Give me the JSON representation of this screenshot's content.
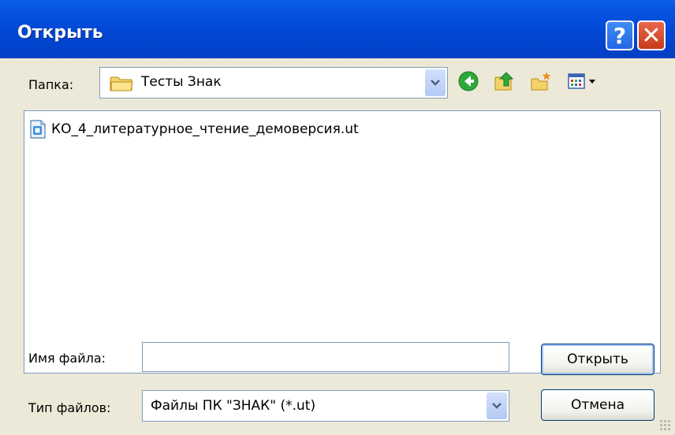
{
  "window": {
    "title": "Открыть",
    "help_label": "?",
    "close_label": "✕"
  },
  "lookin": {
    "label": "Папка:",
    "value": "Тесты Знак"
  },
  "toolbar": {
    "icons": [
      "back-icon",
      "up-folder-icon",
      "new-folder-icon",
      "view-menu-icon"
    ]
  },
  "files": [
    {
      "name": "КО_4_литературное_чтение_демоверсия.ut"
    }
  ],
  "filename": {
    "label": "Имя файла:",
    "value": "",
    "placeholder": ""
  },
  "filetype": {
    "label": "Тип файлов:",
    "value": "Файлы ПК \"ЗНАК\" (*.ut)"
  },
  "buttons": {
    "open": "Открыть",
    "cancel": "Отмена"
  },
  "colors": {
    "titlebar": "#0247d4",
    "dialog_bg": "#ece9d8",
    "input_border": "#7f9db9"
  }
}
